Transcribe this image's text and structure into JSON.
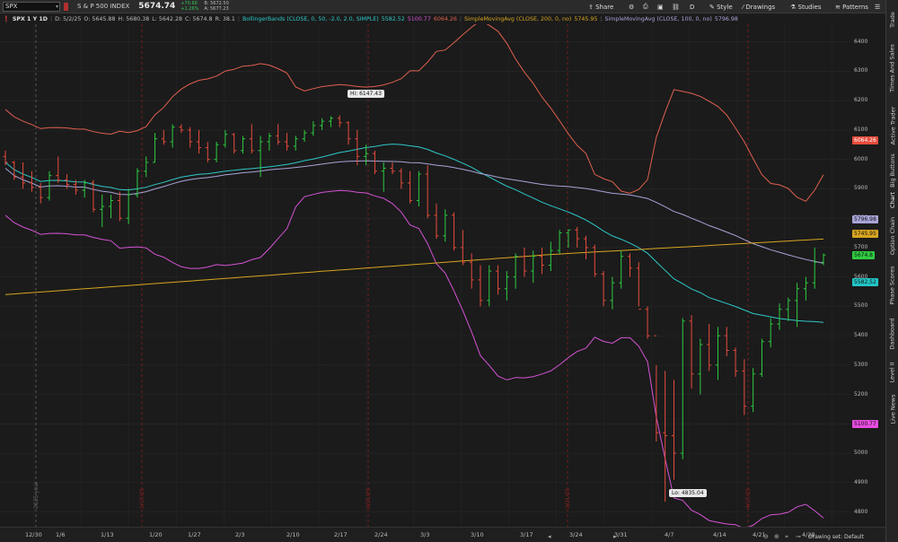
{
  "toolbar": {
    "symbol": "SPX",
    "symbol_desc": "S & P 500 INDEX",
    "last_price": "5674.74",
    "net_change": "+70.60",
    "pct_change": "+1.26%",
    "bid": "B: 5672.50",
    "ask": "A: 5677.23",
    "share_label": "Share",
    "style_label": "Style",
    "drawings_label": "Drawings",
    "studies_label": "Studies",
    "patterns_label": "Patterns",
    "period_letter": "D"
  },
  "header": {
    "title": "SPX 1 Y 1D",
    "date": "D: 5/2/25",
    "open": "O: 5645.88",
    "high": "H: 5680.38",
    "low": "L: 5642.28",
    "close": "C: 5674.8",
    "range": "R: 38.1",
    "bb_label": "BollingerBands (CLOSE, 0, 50, -2.0, 2.0, SIMPLE)",
    "bb_mid": "5582.52",
    "bb_low": "5100.77",
    "bb_up": "6064.26",
    "sma200_label": "SimpleMovingAvg (CLOSE, 200, 0, no)",
    "sma200_val": "5745.95",
    "sma100_label": "SimpleMovingAvg (CLOSE, 100, 0, no)",
    "sma100_val": "5796.98"
  },
  "side_tabs": [
    "Trade",
    "Times And Sales",
    "Active Trader",
    "Big Buttons",
    "Chart",
    "Option Chain",
    "Phase Scores",
    "Dashboard",
    "Level II",
    "Live News"
  ],
  "price_axis": {
    "labels": [
      "6400",
      "6300",
      "6200",
      "6100",
      "6000",
      "5900",
      "5800",
      "5700",
      "5600",
      "5500",
      "5400",
      "5300",
      "5200",
      "5100",
      "5000",
      "4900",
      "4800"
    ],
    "badges": [
      {
        "text": "6064.26",
        "bg": "#e74c3c",
        "fg": "#ffffff",
        "price": 6064.26
      },
      {
        "text": "5796.98",
        "bg": "#a8a4d8",
        "fg": "#111111",
        "price": 5796.98
      },
      {
        "text": "5745.95",
        "bg": "#d7a520",
        "fg": "#111111",
        "price": 5745.95
      },
      {
        "text": "5674.8",
        "bg": "#2ecc40",
        "fg": "#111111",
        "price": 5674.8
      },
      {
        "text": "5582.52",
        "bg": "#22c5c5",
        "fg": "#111111",
        "price": 5582.52
      },
      {
        "text": "5100.77",
        "bg": "#e74be0",
        "fg": "#111111",
        "price": 5100.77
      }
    ]
  },
  "date_axis": [
    "12/30",
    "1/6",
    "1/13",
    "1/20",
    "1/27",
    "2/3",
    "2/10",
    "2/17",
    "2/24",
    "3/3",
    "3/10",
    "3/17",
    "3/24",
    "3/31",
    "4/7",
    "4/14",
    "4/21",
    "4/28"
  ],
  "annotations": {
    "hi": "Hi: 6147.43",
    "lo": "Lo: 4835.04"
  },
  "vertical_markers": [
    "2025 year",
    "1/17/25",
    "2/21/25",
    "3/21/25",
    "4/17/25"
  ],
  "drawing_set": "Drawing set: Default",
  "colors": {
    "upper_band": "#e0604f",
    "lower_band": "#d653d6",
    "mid_band": "#2fc8c8",
    "sma100": "#a8a4d8",
    "sma200": "#d7a520",
    "up_bar": "#2ecc40",
    "down_bar": "#e74c3c"
  },
  "chart_data": {
    "type": "ohlc",
    "ylim": [
      4750,
      6460
    ],
    "x": [
      "12/30",
      "1/6",
      "1/13",
      "1/20",
      "1/27",
      "2/3",
      "2/10",
      "2/17",
      "2/24",
      "3/3",
      "3/10",
      "3/17",
      "3/24",
      "3/31",
      "4/7",
      "4/14",
      "4/21",
      "4/28"
    ],
    "x_index": [
      3,
      8,
      13,
      18,
      23,
      28,
      33,
      38,
      43,
      48,
      53,
      58,
      63,
      68,
      72,
      77,
      82,
      87
    ],
    "bars": [
      [
        6010,
        6030,
        5980,
        5990
      ],
      [
        5990,
        5995,
        5930,
        5940
      ],
      [
        5940,
        5990,
        5900,
        5920
      ],
      [
        5920,
        5960,
        5890,
        5905
      ],
      [
        5905,
        5920,
        5850,
        5870
      ],
      [
        5870,
        5960,
        5860,
        5945
      ],
      [
        5945,
        6010,
        5920,
        5930
      ],
      [
        5930,
        5950,
        5900,
        5915
      ],
      [
        5915,
        5930,
        5880,
        5895
      ],
      [
        5895,
        5930,
        5870,
        5920
      ],
      [
        5920,
        5930,
        5820,
        5830
      ],
      [
        5830,
        5880,
        5770,
        5840
      ],
      [
        5840,
        5880,
        5800,
        5860
      ],
      [
        5860,
        5890,
        5790,
        5800
      ],
      [
        5800,
        5900,
        5780,
        5880
      ],
      [
        5880,
        5970,
        5870,
        5960
      ],
      [
        5960,
        6010,
        5940,
        5990
      ],
      [
        5990,
        6090,
        5990,
        6070
      ],
      [
        6070,
        6100,
        6050,
        6060
      ],
      [
        6060,
        6120,
        6040,
        6110
      ],
      [
        6110,
        6120,
        6090,
        6100
      ],
      [
        6100,
        6110,
        6040,
        6060
      ],
      [
        6060,
        6100,
        6020,
        6040
      ],
      [
        6040,
        6060,
        5990,
        6000
      ],
      [
        6000,
        6060,
        5990,
        6050
      ],
      [
        6050,
        6100,
        6040,
        6085
      ],
      [
        6085,
        6090,
        6020,
        6030
      ],
      [
        6030,
        6080,
        6020,
        6070
      ],
      [
        6070,
        6120,
        6020,
        6030
      ],
      [
        6030,
        6080,
        5940,
        6060
      ],
      [
        6060,
        6090,
        6030,
        6080
      ],
      [
        6080,
        6120,
        6050,
        6060
      ],
      [
        6060,
        6090,
        6030,
        6045
      ],
      [
        6045,
        6080,
        6030,
        6070
      ],
      [
        6070,
        6100,
        6060,
        6090
      ],
      [
        6090,
        6130,
        6080,
        6115
      ],
      [
        6115,
        6140,
        6100,
        6130
      ],
      [
        6130,
        6147,
        6110,
        6140
      ],
      [
        6140,
        6150,
        6110,
        6125
      ],
      [
        6125,
        6130,
        6050,
        6070
      ],
      [
        6070,
        6100,
        5980,
        6010
      ],
      [
        6010,
        6050,
        5980,
        6020
      ],
      [
        6020,
        6030,
        5950,
        5960
      ],
      [
        5960,
        5990,
        5890,
        5970
      ],
      [
        5970,
        5990,
        5950,
        5960
      ],
      [
        5960,
        5970,
        5900,
        5920
      ],
      [
        5920,
        5960,
        5850,
        5860
      ],
      [
        5860,
        5960,
        5840,
        5950
      ],
      [
        5950,
        5980,
        5800,
        5810
      ],
      [
        5810,
        5850,
        5730,
        5740
      ],
      [
        5740,
        5830,
        5720,
        5810
      ],
      [
        5810,
        5820,
        5690,
        5700
      ],
      [
        5700,
        5760,
        5640,
        5650
      ],
      [
        5650,
        5680,
        5560,
        5590
      ],
      [
        5590,
        5640,
        5500,
        5520
      ],
      [
        5520,
        5640,
        5500,
        5620
      ],
      [
        5620,
        5640,
        5540,
        5560
      ],
      [
        5560,
        5620,
        5520,
        5600
      ],
      [
        5600,
        5680,
        5560,
        5670
      ],
      [
        5670,
        5700,
        5600,
        5620
      ],
      [
        5620,
        5690,
        5580,
        5670
      ],
      [
        5670,
        5700,
        5610,
        5640
      ],
      [
        5640,
        5720,
        5620,
        5690
      ],
      [
        5690,
        5760,
        5680,
        5750
      ],
      [
        5750,
        5760,
        5700,
        5760
      ],
      [
        5760,
        5770,
        5700,
        5730
      ],
      [
        5730,
        5740,
        5660,
        5700
      ],
      [
        5700,
        5710,
        5600,
        5610
      ],
      [
        5610,
        5620,
        5500,
        5520
      ],
      [
        5520,
        5600,
        5490,
        5580
      ],
      [
        5580,
        5690,
        5560,
        5670
      ],
      [
        5670,
        5680,
        5600,
        5630
      ],
      [
        5630,
        5650,
        5500,
        5490
      ],
      [
        5490,
        5500,
        5390,
        5400
      ],
      [
        5400,
        5300,
        5040,
        5070
      ],
      [
        5070,
        5280,
        4835,
        5060
      ],
      [
        5060,
        5250,
        4910,
        5000
      ],
      [
        5000,
        5460,
        4980,
        5450
      ],
      [
        5450,
        5470,
        5220,
        5270
      ],
      [
        5270,
        5390,
        5200,
        5370
      ],
      [
        5370,
        5440,
        5280,
        5300
      ],
      [
        5300,
        5430,
        5250,
        5400
      ],
      [
        5400,
        5430,
        5330,
        5350
      ],
      [
        5350,
        5360,
        5260,
        5280
      ],
      [
        5280,
        5320,
        5130,
        5160
      ],
      [
        5160,
        5290,
        5140,
        5270
      ],
      [
        5270,
        5390,
        5260,
        5380
      ],
      [
        5380,
        5460,
        5360,
        5440
      ],
      [
        5440,
        5510,
        5420,
        5490
      ],
      [
        5490,
        5530,
        5450,
        5520
      ],
      [
        5520,
        5580,
        5430,
        5560
      ],
      [
        5560,
        5600,
        5520,
        5580
      ],
      [
        5580,
        5700,
        5560,
        5650
      ],
      [
        5650,
        5680,
        5640,
        5674.8
      ]
    ]
  }
}
